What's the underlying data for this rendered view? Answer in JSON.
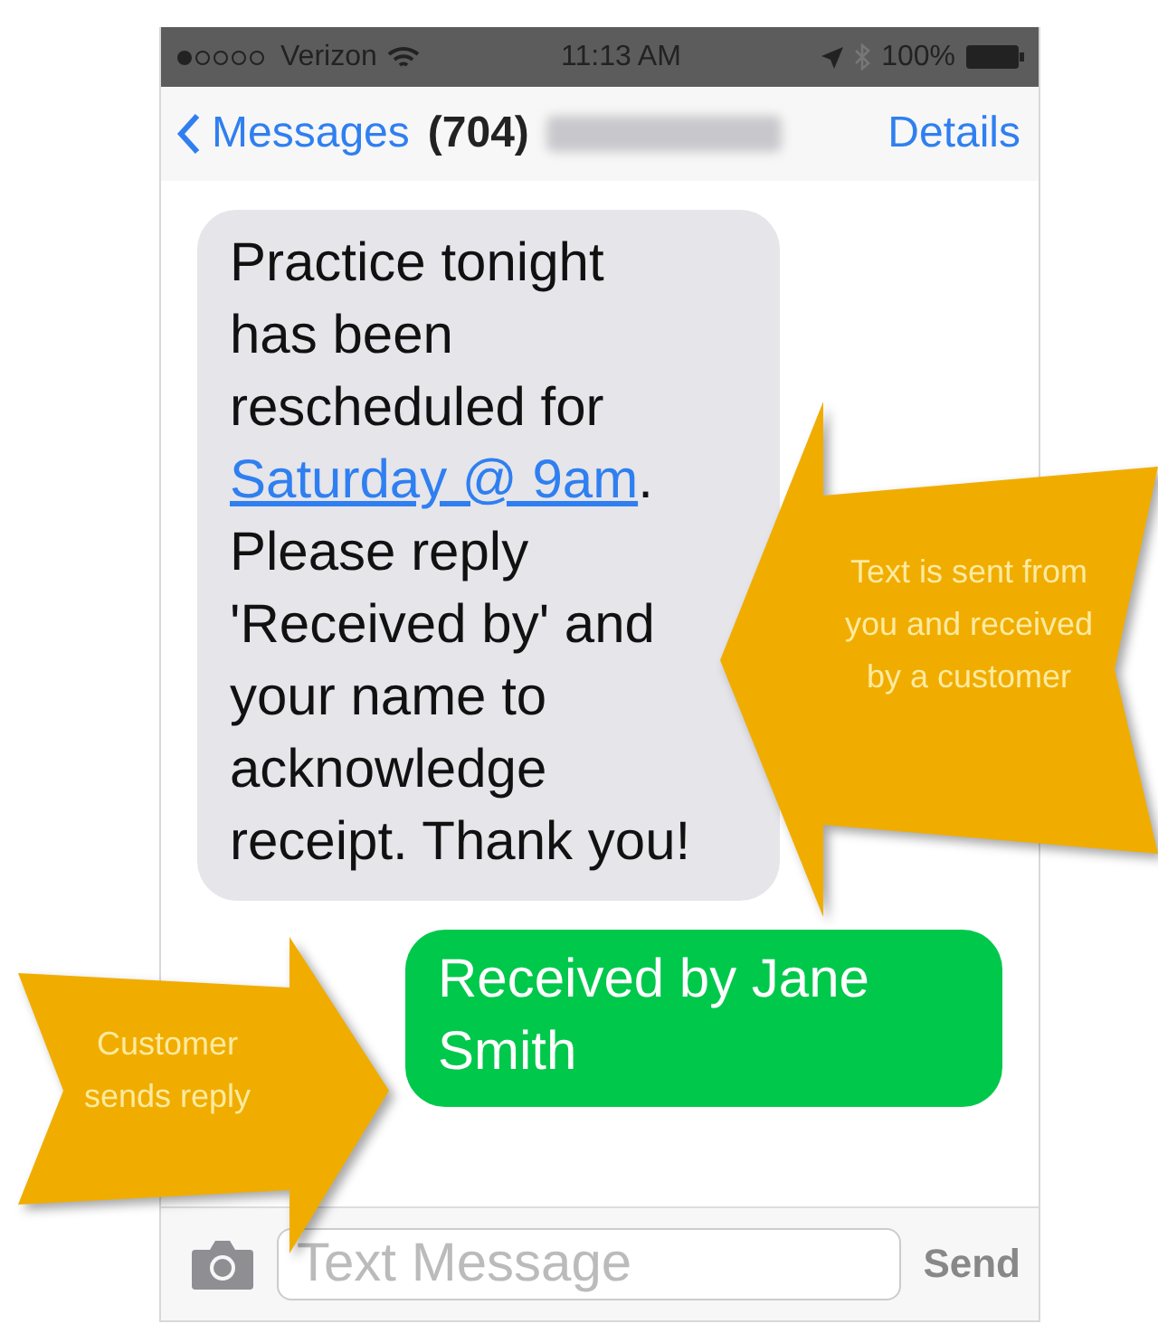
{
  "status_bar": {
    "carrier": "Verizon",
    "time": "11:13 AM",
    "battery": "100%"
  },
  "nav_bar": {
    "back": "Messages",
    "title": "(704)",
    "action": "Details"
  },
  "messages": [
    {
      "kind": "incoming",
      "before": "Practice tonight has been rescheduled for ",
      "link": "Saturday @ 9am",
      "after": ". Please reply 'Received by' and your name to acknowledge receipt. Thank you!"
    },
    {
      "kind": "outgoing",
      "before": "Received by Jane Smith"
    }
  ],
  "composer": {
    "placeholder": "Text Message",
    "send": "Send"
  },
  "callouts": [
    {
      "kind": "left",
      "text": "Text is sent from you and received by a customer"
    },
    {
      "kind": "right",
      "text": "Customer sends reply"
    }
  ]
}
